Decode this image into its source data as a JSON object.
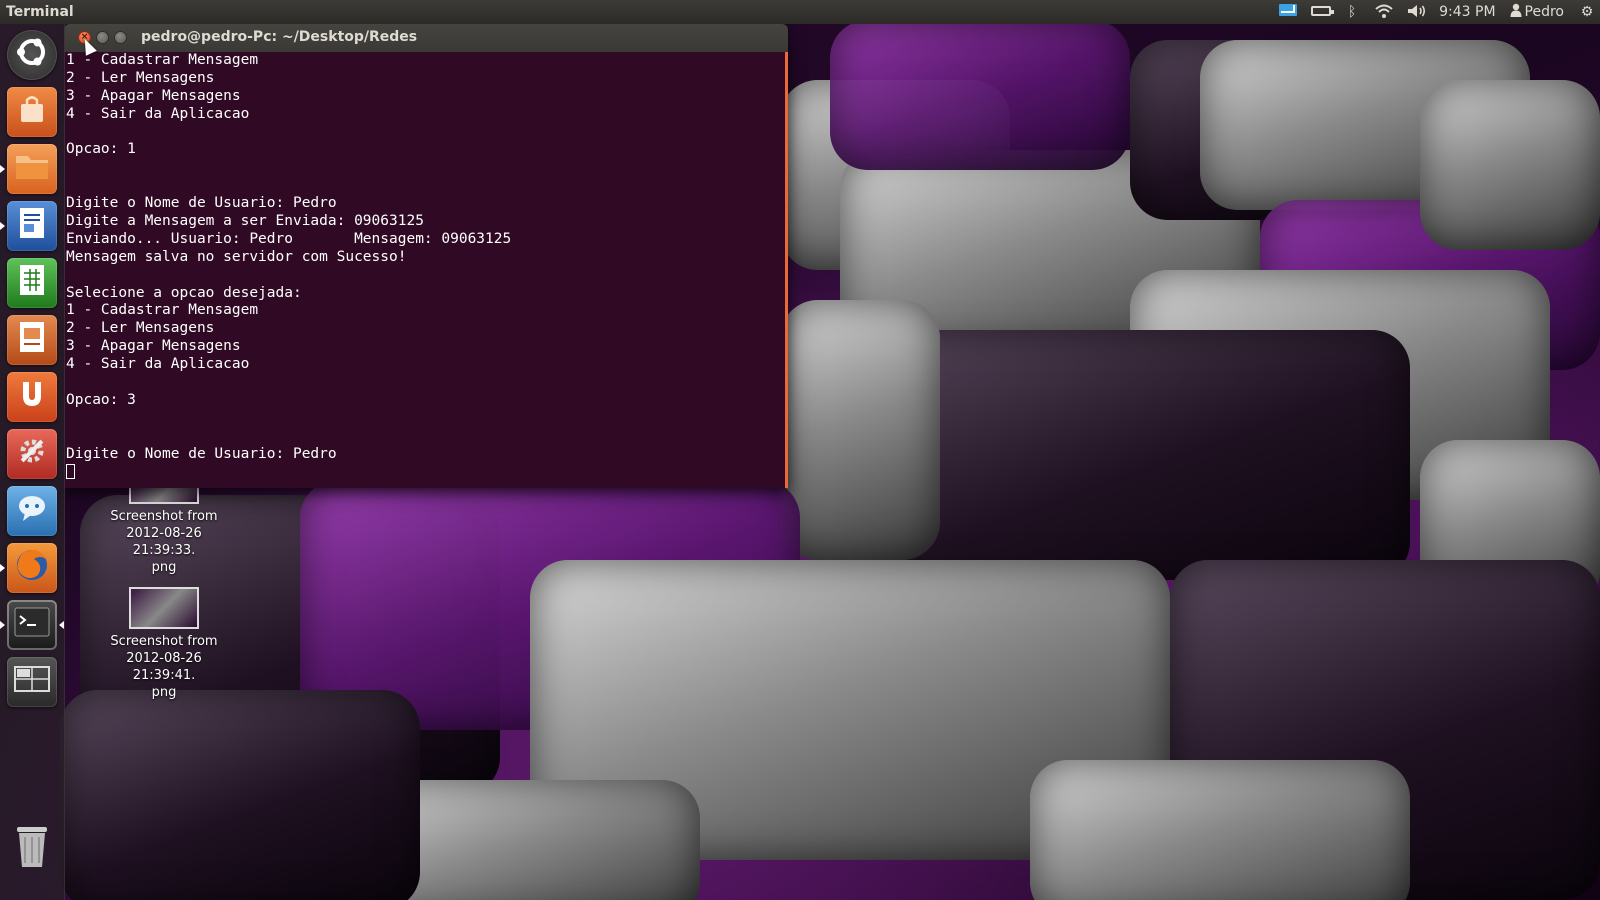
{
  "top_panel": {
    "app_title": "Terminal",
    "clock": "9:43 PM",
    "user": "Pedro",
    "indicators": [
      "mail-icon",
      "battery-icon",
      "bluetooth-icon",
      "wifi-icon",
      "volume-icon",
      "session-gear-icon"
    ]
  },
  "launcher": {
    "items": [
      {
        "name": "dash-home",
        "icon": "ubuntu-logo-icon"
      },
      {
        "name": "software-center",
        "icon": "shopping-bag-icon"
      },
      {
        "name": "files",
        "icon": "folder-icon"
      },
      {
        "name": "libreoffice-writer",
        "icon": "document-icon"
      },
      {
        "name": "libreoffice-calc",
        "icon": "spreadsheet-icon"
      },
      {
        "name": "libreoffice-impress",
        "icon": "presentation-icon"
      },
      {
        "name": "ubuntu-one",
        "icon": "ubuntu-one-icon"
      },
      {
        "name": "system-settings",
        "icon": "wrench-gear-icon"
      },
      {
        "name": "empathy",
        "icon": "chat-icon"
      },
      {
        "name": "firefox",
        "icon": "firefox-icon"
      },
      {
        "name": "terminal",
        "icon": "terminal-icon"
      },
      {
        "name": "workspace-switcher",
        "icon": "workspace-icon"
      },
      {
        "name": "trash",
        "icon": "trash-icon"
      }
    ]
  },
  "desktop": {
    "icons": [
      {
        "line1": "Screenshot from",
        "line2": "2012-08-26 21:39:33.",
        "line3": "png"
      },
      {
        "line1": "Screenshot from",
        "line2": "2012-08-26 21:39:41.",
        "line3": "png"
      }
    ]
  },
  "terminal": {
    "title": "pedro@pedro-Pc: ~/Desktop/Redes",
    "lines": [
      "1 - Cadastrar Mensagem",
      "2 - Ler Mensagens",
      "3 - Apagar Mensagens",
      "4 - Sair da Aplicacao",
      "",
      "Opcao: 1",
      "",
      "",
      "Digite o Nome de Usuario: Pedro",
      "Digite a Mensagem a ser Enviada: 09063125",
      "Enviando... Usuario: Pedro       Mensagem: 09063125",
      "Mensagem salva no servidor com Sucesso!",
      "",
      "Selecione a opcao desejada:",
      "1 - Cadastrar Mensagem",
      "2 - Ler Mensagens",
      "3 - Apagar Mensagens",
      "4 - Sair da Aplicacao",
      "",
      "Opcao: 3",
      "",
      "",
      "Digite o Nome de Usuario: Pedro"
    ]
  },
  "colors": {
    "terminal_bg": "#300a24",
    "panel_bg": "#3c3b37",
    "accent": "#e96a37"
  }
}
